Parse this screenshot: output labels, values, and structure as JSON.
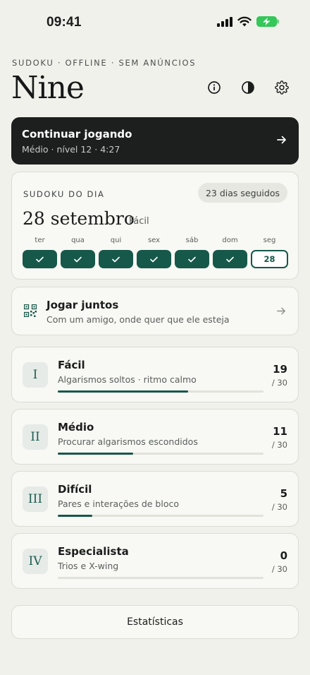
{
  "status_bar": {
    "time": "09:41"
  },
  "header": {
    "eyebrow": "SUDOKU · OFFLINE · SEM ANÚNCIOS",
    "title": "Nine",
    "icons": [
      "info-icon",
      "contrast-icon",
      "gear-icon"
    ]
  },
  "continue": {
    "title": "Continuar jogando",
    "subtitle": "Médio · nível 12 · 4:27"
  },
  "daily": {
    "label": "SUDOKU DO DIA",
    "streak": "23 dias seguidos",
    "date": "28 setembro",
    "level": "Fácil",
    "days": [
      {
        "name": "ter",
        "done": true
      },
      {
        "name": "qua",
        "done": true
      },
      {
        "name": "qui",
        "done": true
      },
      {
        "name": "sex",
        "done": true
      },
      {
        "name": "sáb",
        "done": true
      },
      {
        "name": "dom",
        "done": true
      },
      {
        "name": "seg",
        "done": false,
        "today_label": "28"
      }
    ]
  },
  "together": {
    "title": "Jogar juntos",
    "subtitle": "Com um amigo, onde quer que ele esteja"
  },
  "levels": [
    {
      "numeral": "I",
      "name": "Fácil",
      "desc": "Algarismos soltos · ritmo calmo",
      "count": "19",
      "total": "/ 30",
      "progress": 0.633
    },
    {
      "numeral": "II",
      "name": "Médio",
      "desc": "Procurar algarismos escondidos",
      "count": "11",
      "total": "/ 30",
      "progress": 0.367
    },
    {
      "numeral": "III",
      "name": "Difícil",
      "desc": "Pares e interações de bloco",
      "count": "5",
      "total": "/ 30",
      "progress": 0.167
    },
    {
      "numeral": "IV",
      "name": "Especialista",
      "desc": "Trios e X-wing",
      "count": "0",
      "total": "/ 30",
      "progress": 0
    }
  ],
  "stats_label": "Estatísticas",
  "colors": {
    "accent": "#16584a",
    "background": "#f1f1ec",
    "dark_card": "#1c1f1e",
    "battery": "#34c759"
  }
}
